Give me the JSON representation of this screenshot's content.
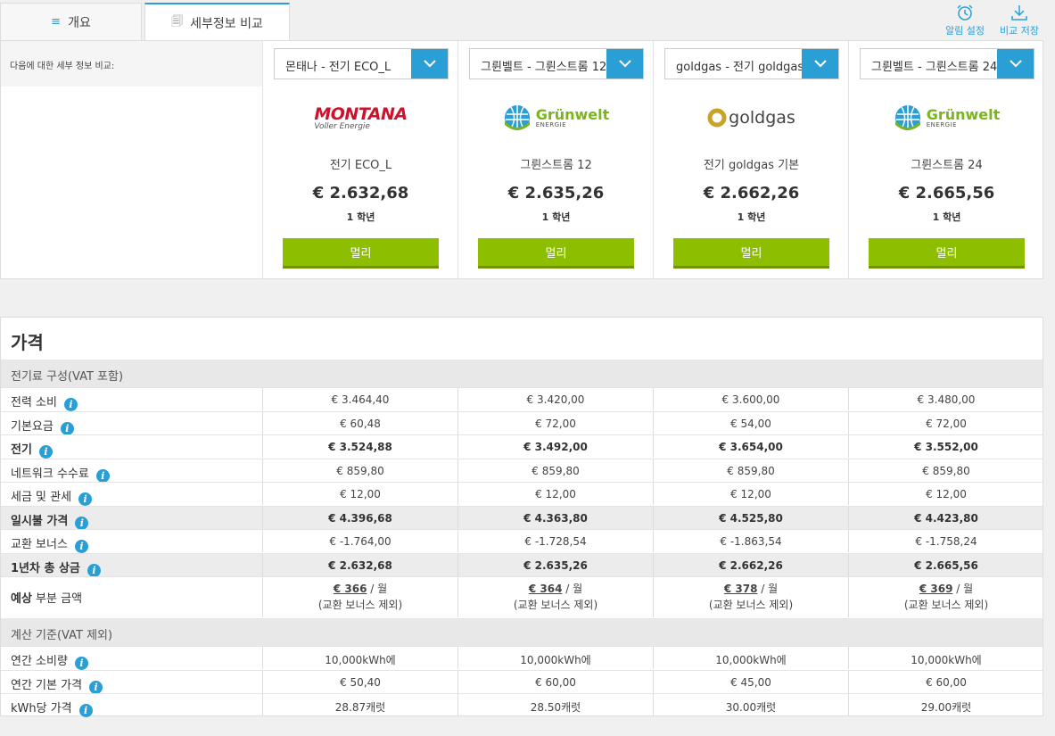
{
  "tabs": [
    {
      "label": "개요"
    },
    {
      "label": "세부정보 비교"
    }
  ],
  "actions": {
    "alarm": "알림 설정",
    "save": "비교 저장"
  },
  "compare_label": "다음에 대한 세부 정보 비교:",
  "tariffs": [
    {
      "select": "몬태나 - 전기 ECO_L",
      "brand": "MONTANA",
      "brand_sub": "Voller Energie",
      "name": "전기 ECO_L",
      "price": "€ 2.632,68",
      "period": "1 학년",
      "button": "멀리"
    },
    {
      "select": "그륀벨트 - 그륀스트롬 12",
      "brand": "Grünwelt",
      "brand_sub": "ENERGIE",
      "name": "그륀스트롬 12",
      "price": "€ 2.635,26",
      "period": "1 학년",
      "button": "멀리"
    },
    {
      "select": "goldgas - 전기 goldgas 기본",
      "brand": "goldgas",
      "brand_sub": "",
      "name": "전기 goldgas 기본",
      "price": "€ 2.662,26",
      "period": "1 학년",
      "button": "멀리"
    },
    {
      "select": "그륀벨트 - 그륀스트롬 24",
      "brand": "Grünwelt",
      "brand_sub": "ENERGIE",
      "name": "그륀스트롬 24",
      "price": "€ 2.665,56",
      "period": "1 학년",
      "button": "멀리"
    }
  ],
  "prices": {
    "title": "가격",
    "section1": "전기료 구성(VAT 포함)",
    "rows1": [
      {
        "label": "전력 소비",
        "values": [
          "€ 3.464,40",
          "€ 3.420,00",
          "€ 3.600,00",
          "€ 3.480,00"
        ]
      },
      {
        "label": "기본요금",
        "values": [
          "€ 60,48",
          "€ 72,00",
          "€ 54,00",
          "€ 72,00"
        ]
      },
      {
        "label": "전기",
        "values": [
          "€ 3.524,88",
          "€ 3.492,00",
          "€ 3.654,00",
          "€ 3.552,00"
        ]
      },
      {
        "label": "네트워크 수수료",
        "values": [
          "€ 859,80",
          "€ 859,80",
          "€ 859,80",
          "€ 859,80"
        ]
      },
      {
        "label": "세금 및 관세",
        "values": [
          "€ 12,00",
          "€ 12,00",
          "€ 12,00",
          "€ 12,00"
        ]
      },
      {
        "label": "일시불 가격",
        "values": [
          "€ 4.396,68",
          "€ 4.363,80",
          "€ 4.525,80",
          "€ 4.423,80"
        ]
      },
      {
        "label": "교환 보너스",
        "values": [
          "€ -1.764,00",
          "€ -1.728,54",
          "€ -1.863,54",
          "€ -1.758,24"
        ]
      },
      {
        "label": "1년차 총 상금",
        "values": [
          "€ 2.632,68",
          "€ 2.635,26",
          "€ 2.662,26",
          "€ 2.665,56"
        ]
      }
    ],
    "estimate": {
      "label_bold": "예상",
      "label_rest": " 부분 금액",
      "amounts": [
        "€ 366",
        "€ 364",
        "€ 378",
        "€ 369"
      ],
      "per": " / 월",
      "note": "(교환 보너스 제외)"
    },
    "section2": "계산 기준(VAT 제외)",
    "rows2": [
      {
        "label": "연간 소비량",
        "values": [
          "10,000kWh에",
          "10,000kWh에",
          "10,000kWh에",
          "10,000kWh에"
        ]
      },
      {
        "label": "연간 기본 가격",
        "values": [
          "€ 50,40",
          "€ 60,00",
          "€ 45,00",
          "€ 60,00"
        ]
      },
      {
        "label": "kWh당 가격",
        "values": [
          "28.87캐럿",
          "28.50캐럿",
          "30.00캐럿",
          "29.00캐럿"
        ]
      }
    ]
  },
  "colors": {
    "accent": "#2a9fd6",
    "button": "#8dbf00",
    "montana": "#d0112b",
    "gruenwelt": "#7ab51d",
    "goldgas": "#c9a227"
  }
}
